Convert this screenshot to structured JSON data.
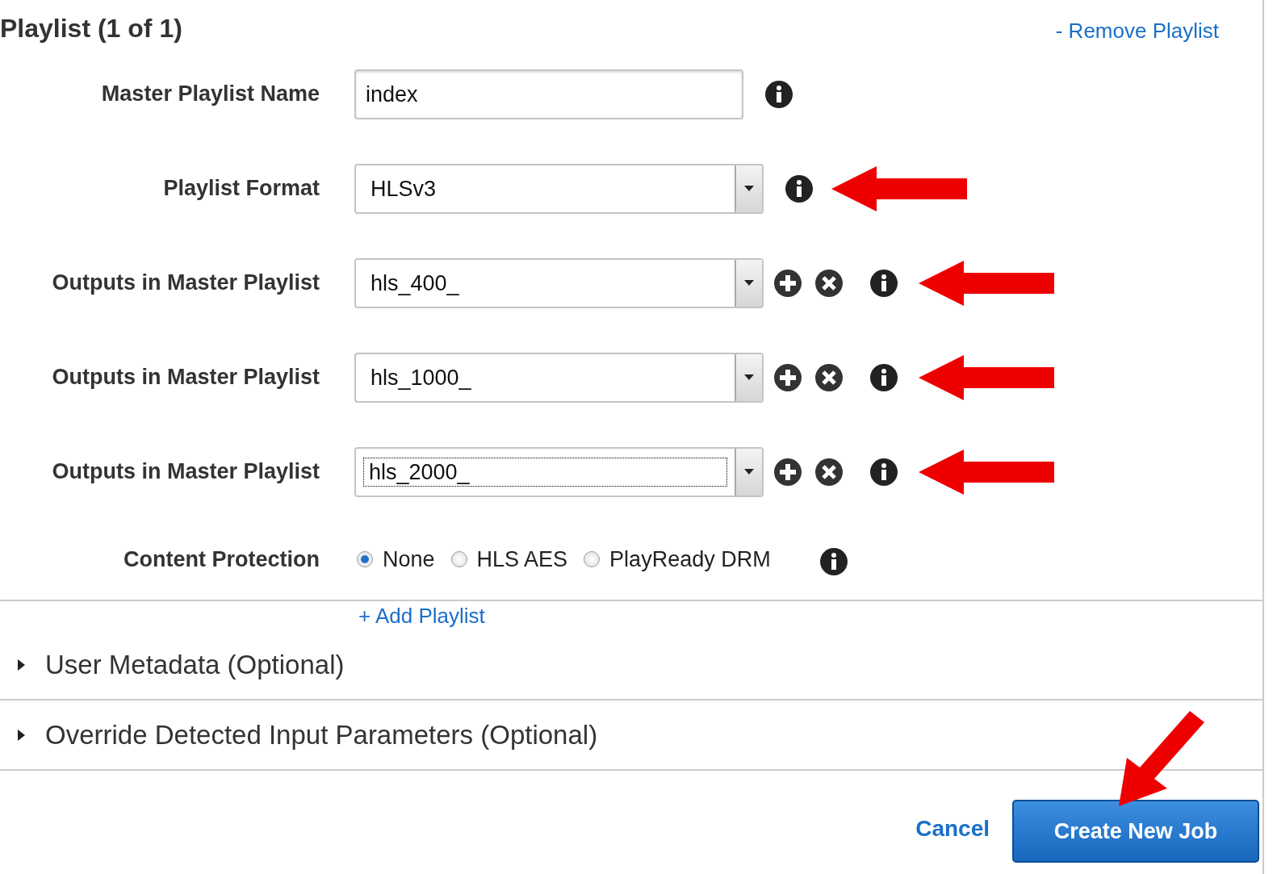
{
  "title": "Playlist (1 of 1)",
  "remove_link": "- Remove Playlist",
  "fields": [
    {
      "kind": "text",
      "label": "Master Playlist Name",
      "value": "index",
      "annotated": false,
      "focused": false
    },
    {
      "kind": "select",
      "label": "Playlist Format",
      "value": "HLSv3",
      "annotated": true,
      "focused": false
    },
    {
      "kind": "multi-select",
      "label": "Outputs in Master Playlist",
      "value": "hls_400_",
      "annotated": true,
      "focused": false
    },
    {
      "kind": "multi-select",
      "label": "Outputs in Master Playlist",
      "value": "hls_1000_",
      "annotated": true,
      "focused": false
    },
    {
      "kind": "multi-select",
      "label": "Outputs in Master Playlist",
      "value": "hls_2000_",
      "annotated": true,
      "focused": true
    }
  ],
  "content_protection": {
    "label": "Content Protection",
    "options": [
      {
        "label": "None",
        "selected": true
      },
      {
        "label": "HLS AES",
        "selected": false
      },
      {
        "label": "PlayReady DRM",
        "selected": false
      }
    ]
  },
  "add_link": "+ Add Playlist",
  "sections": [
    {
      "label": "User Metadata (Optional)",
      "expanded": false
    },
    {
      "label": "Override Detected Input Parameters (Optional)",
      "expanded": false
    }
  ],
  "cancel": {
    "label": "Cancel"
  },
  "submit": {
    "label": "Create New Job",
    "annotated": true
  }
}
